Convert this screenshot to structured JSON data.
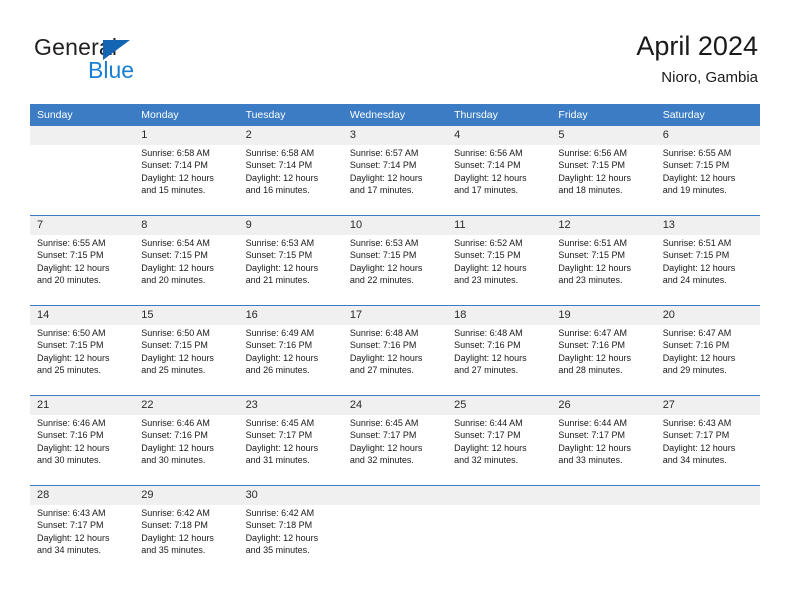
{
  "brand": {
    "name_primary": "General",
    "name_secondary": "Blue",
    "accent_color": "#1b7fd4",
    "triangle_color": "#1464b4"
  },
  "header": {
    "title": "April 2024",
    "subtitle": "Nioro, Gambia",
    "header_bar_color": "#3b7cc4",
    "day_number_row_color": "#f0f0f0"
  },
  "weekdays": [
    "Sunday",
    "Monday",
    "Tuesday",
    "Wednesday",
    "Thursday",
    "Friday",
    "Saturday"
  ],
  "weeks": [
    {
      "numbers": [
        "",
        "1",
        "2",
        "3",
        "4",
        "5",
        "6"
      ],
      "cells": [
        {
          "sunrise": "",
          "sunset": "",
          "daylight_line1": "",
          "daylight_line2": ""
        },
        {
          "sunrise": "Sunrise: 6:58 AM",
          "sunset": "Sunset: 7:14 PM",
          "daylight_line1": "Daylight: 12 hours",
          "daylight_line2": "and 15 minutes."
        },
        {
          "sunrise": "Sunrise: 6:58 AM",
          "sunset": "Sunset: 7:14 PM",
          "daylight_line1": "Daylight: 12 hours",
          "daylight_line2": "and 16 minutes."
        },
        {
          "sunrise": "Sunrise: 6:57 AM",
          "sunset": "Sunset: 7:14 PM",
          "daylight_line1": "Daylight: 12 hours",
          "daylight_line2": "and 17 minutes."
        },
        {
          "sunrise": "Sunrise: 6:56 AM",
          "sunset": "Sunset: 7:14 PM",
          "daylight_line1": "Daylight: 12 hours",
          "daylight_line2": "and 17 minutes."
        },
        {
          "sunrise": "Sunrise: 6:56 AM",
          "sunset": "Sunset: 7:15 PM",
          "daylight_line1": "Daylight: 12 hours",
          "daylight_line2": "and 18 minutes."
        },
        {
          "sunrise": "Sunrise: 6:55 AM",
          "sunset": "Sunset: 7:15 PM",
          "daylight_line1": "Daylight: 12 hours",
          "daylight_line2": "and 19 minutes."
        }
      ]
    },
    {
      "numbers": [
        "7",
        "8",
        "9",
        "10",
        "11",
        "12",
        "13"
      ],
      "cells": [
        {
          "sunrise": "Sunrise: 6:55 AM",
          "sunset": "Sunset: 7:15 PM",
          "daylight_line1": "Daylight: 12 hours",
          "daylight_line2": "and 20 minutes."
        },
        {
          "sunrise": "Sunrise: 6:54 AM",
          "sunset": "Sunset: 7:15 PM",
          "daylight_line1": "Daylight: 12 hours",
          "daylight_line2": "and 20 minutes."
        },
        {
          "sunrise": "Sunrise: 6:53 AM",
          "sunset": "Sunset: 7:15 PM",
          "daylight_line1": "Daylight: 12 hours",
          "daylight_line2": "and 21 minutes."
        },
        {
          "sunrise": "Sunrise: 6:53 AM",
          "sunset": "Sunset: 7:15 PM",
          "daylight_line1": "Daylight: 12 hours",
          "daylight_line2": "and 22 minutes."
        },
        {
          "sunrise": "Sunrise: 6:52 AM",
          "sunset": "Sunset: 7:15 PM",
          "daylight_line1": "Daylight: 12 hours",
          "daylight_line2": "and 23 minutes."
        },
        {
          "sunrise": "Sunrise: 6:51 AM",
          "sunset": "Sunset: 7:15 PM",
          "daylight_line1": "Daylight: 12 hours",
          "daylight_line2": "and 23 minutes."
        },
        {
          "sunrise": "Sunrise: 6:51 AM",
          "sunset": "Sunset: 7:15 PM",
          "daylight_line1": "Daylight: 12 hours",
          "daylight_line2": "and 24 minutes."
        }
      ]
    },
    {
      "numbers": [
        "14",
        "15",
        "16",
        "17",
        "18",
        "19",
        "20"
      ],
      "cells": [
        {
          "sunrise": "Sunrise: 6:50 AM",
          "sunset": "Sunset: 7:15 PM",
          "daylight_line1": "Daylight: 12 hours",
          "daylight_line2": "and 25 minutes."
        },
        {
          "sunrise": "Sunrise: 6:50 AM",
          "sunset": "Sunset: 7:15 PM",
          "daylight_line1": "Daylight: 12 hours",
          "daylight_line2": "and 25 minutes."
        },
        {
          "sunrise": "Sunrise: 6:49 AM",
          "sunset": "Sunset: 7:16 PM",
          "daylight_line1": "Daylight: 12 hours",
          "daylight_line2": "and 26 minutes."
        },
        {
          "sunrise": "Sunrise: 6:48 AM",
          "sunset": "Sunset: 7:16 PM",
          "daylight_line1": "Daylight: 12 hours",
          "daylight_line2": "and 27 minutes."
        },
        {
          "sunrise": "Sunrise: 6:48 AM",
          "sunset": "Sunset: 7:16 PM",
          "daylight_line1": "Daylight: 12 hours",
          "daylight_line2": "and 27 minutes."
        },
        {
          "sunrise": "Sunrise: 6:47 AM",
          "sunset": "Sunset: 7:16 PM",
          "daylight_line1": "Daylight: 12 hours",
          "daylight_line2": "and 28 minutes."
        },
        {
          "sunrise": "Sunrise: 6:47 AM",
          "sunset": "Sunset: 7:16 PM",
          "daylight_line1": "Daylight: 12 hours",
          "daylight_line2": "and 29 minutes."
        }
      ]
    },
    {
      "numbers": [
        "21",
        "22",
        "23",
        "24",
        "25",
        "26",
        "27"
      ],
      "cells": [
        {
          "sunrise": "Sunrise: 6:46 AM",
          "sunset": "Sunset: 7:16 PM",
          "daylight_line1": "Daylight: 12 hours",
          "daylight_line2": "and 30 minutes."
        },
        {
          "sunrise": "Sunrise: 6:46 AM",
          "sunset": "Sunset: 7:16 PM",
          "daylight_line1": "Daylight: 12 hours",
          "daylight_line2": "and 30 minutes."
        },
        {
          "sunrise": "Sunrise: 6:45 AM",
          "sunset": "Sunset: 7:17 PM",
          "daylight_line1": "Daylight: 12 hours",
          "daylight_line2": "and 31 minutes."
        },
        {
          "sunrise": "Sunrise: 6:45 AM",
          "sunset": "Sunset: 7:17 PM",
          "daylight_line1": "Daylight: 12 hours",
          "daylight_line2": "and 32 minutes."
        },
        {
          "sunrise": "Sunrise: 6:44 AM",
          "sunset": "Sunset: 7:17 PM",
          "daylight_line1": "Daylight: 12 hours",
          "daylight_line2": "and 32 minutes."
        },
        {
          "sunrise": "Sunrise: 6:44 AM",
          "sunset": "Sunset: 7:17 PM",
          "daylight_line1": "Daylight: 12 hours",
          "daylight_line2": "and 33 minutes."
        },
        {
          "sunrise": "Sunrise: 6:43 AM",
          "sunset": "Sunset: 7:17 PM",
          "daylight_line1": "Daylight: 12 hours",
          "daylight_line2": "and 34 minutes."
        }
      ]
    },
    {
      "numbers": [
        "28",
        "29",
        "30",
        "",
        "",
        "",
        ""
      ],
      "cells": [
        {
          "sunrise": "Sunrise: 6:43 AM",
          "sunset": "Sunset: 7:17 PM",
          "daylight_line1": "Daylight: 12 hours",
          "daylight_line2": "and 34 minutes."
        },
        {
          "sunrise": "Sunrise: 6:42 AM",
          "sunset": "Sunset: 7:18 PM",
          "daylight_line1": "Daylight: 12 hours",
          "daylight_line2": "and 35 minutes."
        },
        {
          "sunrise": "Sunrise: 6:42 AM",
          "sunset": "Sunset: 7:18 PM",
          "daylight_line1": "Daylight: 12 hours",
          "daylight_line2": "and 35 minutes."
        },
        {
          "sunrise": "",
          "sunset": "",
          "daylight_line1": "",
          "daylight_line2": ""
        },
        {
          "sunrise": "",
          "sunset": "",
          "daylight_line1": "",
          "daylight_line2": ""
        },
        {
          "sunrise": "",
          "sunset": "",
          "daylight_line1": "",
          "daylight_line2": ""
        },
        {
          "sunrise": "",
          "sunset": "",
          "daylight_line1": "",
          "daylight_line2": ""
        }
      ]
    }
  ]
}
